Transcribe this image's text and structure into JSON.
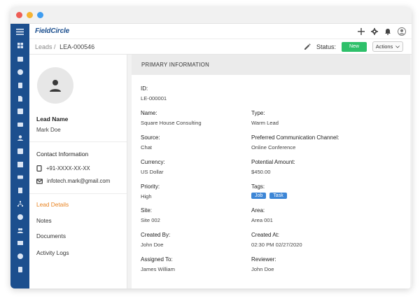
{
  "window": {
    "dots": [
      "#ee5d55",
      "#f5b332",
      "#3f9df0"
    ]
  },
  "app": {
    "logo": "FieldCircle"
  },
  "topbar": {
    "icons": [
      "plus-icon",
      "gear-icon",
      "bell-icon",
      "user-icon"
    ]
  },
  "breadcrumb": {
    "link": "Leads",
    "separator": "/",
    "current": "LEA-000546"
  },
  "status": {
    "label": "Status:",
    "value": "New",
    "actions_label": "Actions"
  },
  "lead": {
    "title": "Lead Name",
    "name": "Mark Doe"
  },
  "contact": {
    "title": "Contact Information",
    "phone": "+91-XXXX-XX-XX",
    "email": "infotech.mark@gmail.com"
  },
  "nav": {
    "items": [
      {
        "label": "Lead Details",
        "active": true
      },
      {
        "label": "Notes",
        "active": false
      },
      {
        "label": "Documents",
        "active": false
      },
      {
        "label": "Activity Logs",
        "active": false
      }
    ]
  },
  "section": {
    "title": "PRIMARY INFORMATION"
  },
  "fields": {
    "id": {
      "label": "ID:",
      "value": "LE-000001"
    },
    "name": {
      "label": "Name:",
      "value": "Square House Consulting"
    },
    "type": {
      "label": "Type:",
      "value": "Warm Lead"
    },
    "source": {
      "label": "Source:",
      "value": "Chat"
    },
    "channel": {
      "label": "Preferred Communication Channel:",
      "value": "Online Conference"
    },
    "currency": {
      "label": "Currency:",
      "value": "US Dollar"
    },
    "amount": {
      "label": "Potential Amount:",
      "value": "$450.00"
    },
    "priority": {
      "label": "Priority:",
      "value": "High"
    },
    "tags": {
      "label": "Tags:",
      "values": [
        "Job",
        "Task"
      ]
    },
    "site": {
      "label": "Site:",
      "value": "Site 002"
    },
    "area": {
      "label": "Area:",
      "value": "Area 001"
    },
    "created_by": {
      "label": "Created By:",
      "value": "John Doe"
    },
    "created_at": {
      "label": "Created At:",
      "value": "02:30 PM 02/27/2020"
    },
    "assigned_to": {
      "label": "Assigned To:",
      "value": "James William"
    },
    "reviewer": {
      "label": "Reviewer:",
      "value": "John Doe"
    }
  },
  "colors": {
    "brand": "#1c4f8e",
    "active_nav": "#e8821e",
    "status_green": "#2ec06a",
    "tag_blue": "#3d86d6"
  }
}
